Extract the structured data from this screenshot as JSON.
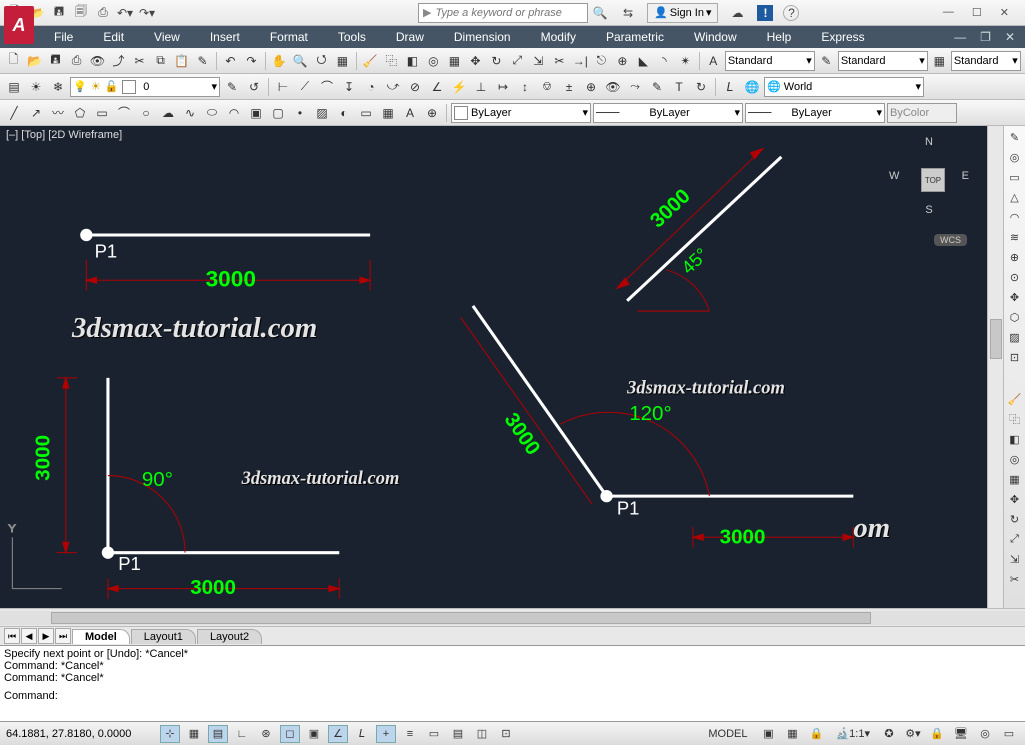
{
  "title_strip": {
    "search_placeholder": "Type a keyword or phrase",
    "sign_in_label": "Sign In"
  },
  "menu": [
    "File",
    "Edit",
    "View",
    "Insert",
    "Format",
    "Tools",
    "Draw",
    "Dimension",
    "Modify",
    "Parametric",
    "Window",
    "Help",
    "Express"
  ],
  "row1": {
    "layer": "0",
    "style1": "Standard",
    "style2": "Standard",
    "style3": "Standard"
  },
  "row2": {
    "world": "World"
  },
  "row3": {
    "bylayer_label": "ByLayer",
    "lt_label": "ByLayer",
    "lw_label": "ByLayer",
    "color_label": "ByColor"
  },
  "viewport": {
    "header": "[–] [Top] [2D Wireframe]",
    "cube_top": "TOP",
    "compass_n": "N",
    "compass_s": "S",
    "compass_w": "W",
    "compass_e": "E",
    "wcs": "WCS"
  },
  "drawing": {
    "p1": "P1",
    "dim3000": "3000",
    "ang90": "90°",
    "ang45": "45°",
    "ang120": "120°",
    "watermark": "3dsmax-tutorial.com",
    "watermark_tail": "om"
  },
  "tabs": {
    "model": "Model",
    "layout1": "Layout1",
    "layout2": "Layout2"
  },
  "command": {
    "line1": "Specify next point or [Undo]: *Cancel*",
    "line2": "Command: *Cancel*",
    "line3": "Command: *Cancel*",
    "prompt": "Command:"
  },
  "status": {
    "coords": "64.1881, 27.8180, 0.0000",
    "model_btn": "MODEL",
    "scale": "1:1"
  }
}
